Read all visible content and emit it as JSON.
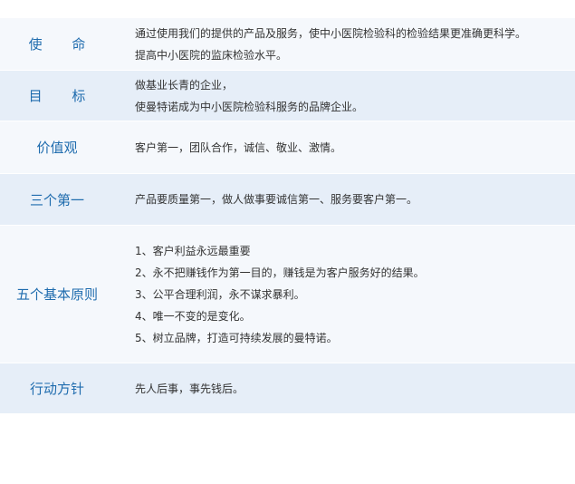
{
  "rows": [
    {
      "label": "使 命",
      "lines": [
        "通过使用我们的提供的产品及服务，使中小医院检验科的检验结果更准确更科学。",
        "提高中小医院的监床检验水平。"
      ]
    },
    {
      "label": "目 标",
      "lines": [
        "做基业长青的企业，",
        "使曼特诺成为中小医院检验科服务的品牌企业。"
      ]
    },
    {
      "label": "价值观",
      "lines": [
        "客户第一，团队合作，诚信、敬业、激情。"
      ]
    },
    {
      "label": "三个第一",
      "lines": [
        "产品要质量第一，做人做事要诚信第一、服务要客户第一。"
      ]
    },
    {
      "label": "五个基本原则",
      "lines": [
        "1、客户利益永远最重要",
        "2、永不把赚钱作为第一目的，赚钱是为客户服务好的结果。",
        "3、公平合理利润，永不谋求暴利。",
        "4、唯一不变的是变化。",
        "5、树立品牌，打造可持续发展的曼特诺。"
      ]
    },
    {
      "label": "行动方针",
      "lines": [
        "先人后事，事先钱后。"
      ]
    }
  ]
}
